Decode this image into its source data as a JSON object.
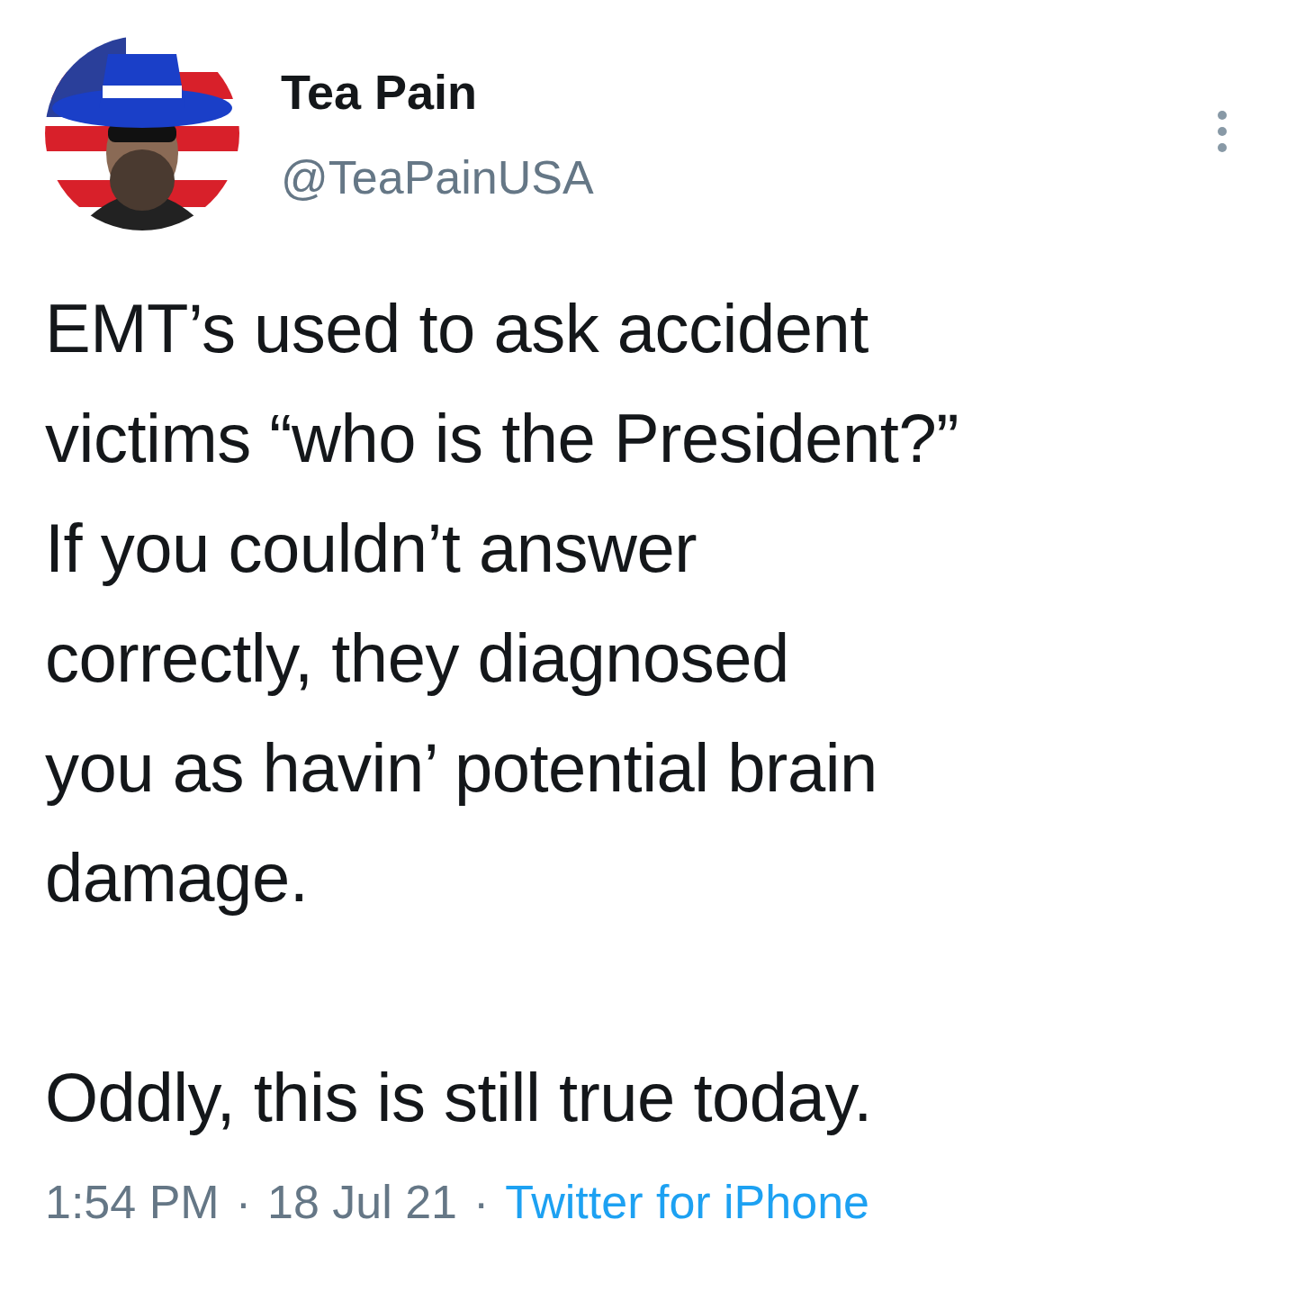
{
  "author": {
    "name": "Tea Pain",
    "handle": "@TeaPainUSA"
  },
  "tweet": {
    "paragraphs": [
      "EMT’s used to ask accident\nvictims “who is the President?”\nIf you couldn’t answer\ncorrectly, they diagnosed\nyou as havin’ potential brain\ndamage.",
      "Oddly, this is still true today."
    ]
  },
  "meta": {
    "time": "1:54 PM",
    "separator": "·",
    "date": "18 Jul 21",
    "source": "Twitter for iPhone"
  }
}
